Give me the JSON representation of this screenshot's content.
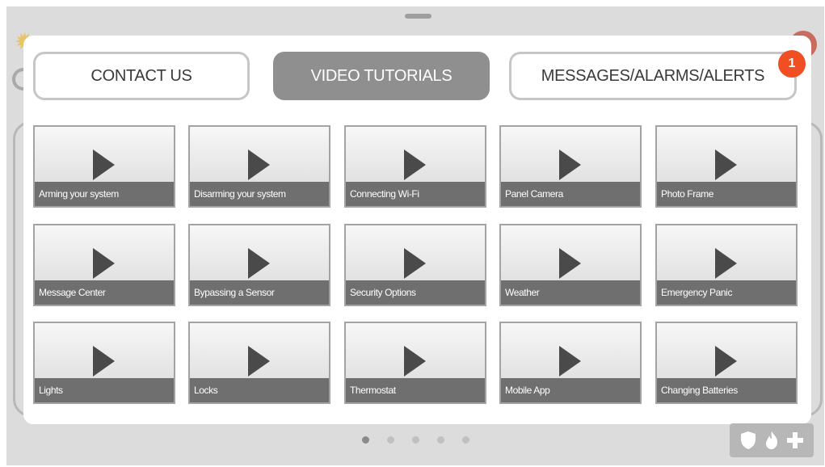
{
  "tabs": {
    "contact_us": "CONTACT US",
    "video_tutorials": "VIDEO TUTORIALS",
    "messages": "MESSAGES/ALARMS/ALERTS",
    "messages_badge": "1"
  },
  "tutorials": [
    {
      "label": "Arming your system"
    },
    {
      "label": "Disarming your system"
    },
    {
      "label": "Connecting Wi-Fi"
    },
    {
      "label": "Panel Camera"
    },
    {
      "label": "Photo Frame"
    },
    {
      "label": "Message Center"
    },
    {
      "label": "Bypassing a Sensor"
    },
    {
      "label": "Security Options"
    },
    {
      "label": "Weather"
    },
    {
      "label": "Emergency Panic"
    },
    {
      "label": "Lights"
    },
    {
      "label": "Locks"
    },
    {
      "label": "Thermostat"
    },
    {
      "label": "Mobile App"
    },
    {
      "label": "Changing Batteries"
    }
  ],
  "pagination": {
    "total_pages": 5,
    "active_page": 1
  },
  "colors": {
    "badge": "#f04e23",
    "active_tab": "#8f8f8f",
    "caption_bar": "#6f6f6f"
  },
  "icons": {
    "play": "play-icon",
    "status": [
      "shield-icon",
      "fire-icon",
      "medical-cross-icon"
    ]
  }
}
